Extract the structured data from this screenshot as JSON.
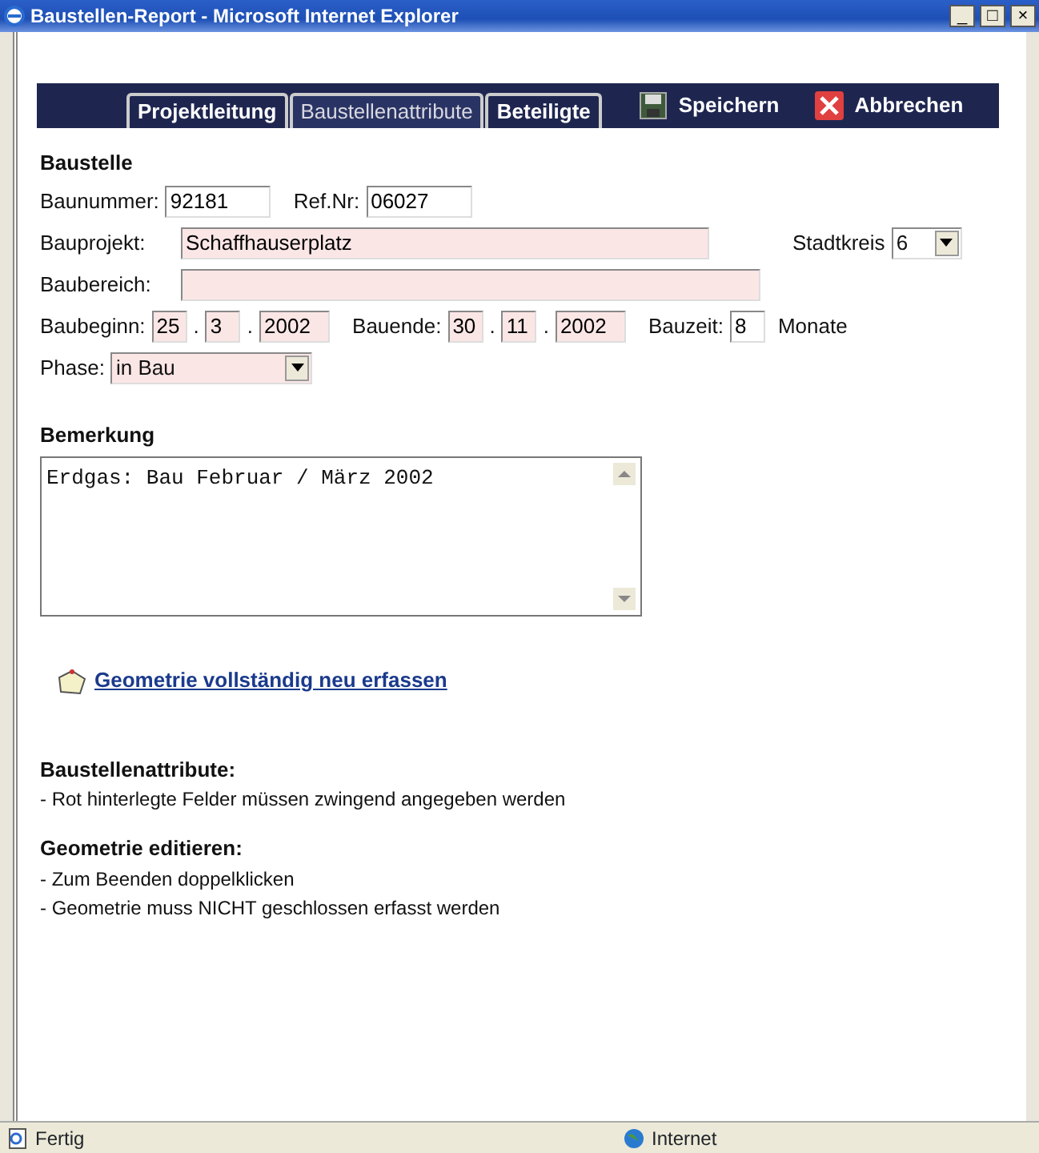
{
  "window": {
    "title": "Baustellen-Report - Microsoft Internet Explorer",
    "controls": [
      "_",
      "□",
      "×"
    ]
  },
  "tabs": [
    {
      "label": "Projektleitung",
      "selected": false
    },
    {
      "label": "Baustellenattribute",
      "selected": true
    },
    {
      "label": "Beteiligte",
      "selected": false
    }
  ],
  "actions": [
    {
      "kind": "save",
      "label": "Speichern"
    },
    {
      "kind": "cancel",
      "label": "Abbrechen"
    }
  ],
  "section_title": "Baustelle",
  "rows": [
    [
      {
        "label": "Baunummer:",
        "value": "92181",
        "required": false
      },
      {
        "label": "Ref.Nr:",
        "value": "06027",
        "required": false
      }
    ],
    [
      {
        "label": "Bauprojekt:",
        "value": "Schaffhauserplatz",
        "required": true
      },
      {
        "label": "Stadtkreis",
        "value": "6",
        "required": false,
        "kind": "select"
      }
    ],
    [
      {
        "label": "Baubereich:",
        "required": true
      }
    ],
    [
      {
        "label": "Baubeginn:",
        "value": "25",
        "required": true
      },
      {
        "label": ".",
        "value": "3",
        "required": true
      },
      {
        "label": ".",
        "value": "2002",
        "required": true
      },
      {
        "label": "Bauende:",
        "value": "30",
        "required": true
      },
      {
        "label": ".",
        "value": "11",
        "required": true
      },
      {
        "label": ".",
        "value": "2002",
        "required": true
      },
      {
        "label": "Bauzeit:",
        "value": "8",
        "required": false,
        "suffix": "Monate"
      }
    ],
    [
      {
        "label": "Phase:",
        "value": "in Bau",
        "required": true,
        "kind": "select"
      }
    ]
  ],
  "remark": {
    "title": "Bemerkung",
    "value": "Erdgas: Bau Februar / März 2002"
  },
  "geometry_link": "Geometrie vollständig neu erfassen",
  "help": [
    {
      "title": "Baustellenattribute:",
      "lines": [
        "- Rot hinterlegte Felder müssen zwingend angegeben werden"
      ]
    },
    {
      "title": "Geometrie editieren:",
      "lines": [
        "- Zum Beenden doppelklicken",
        "- Geometrie muss NICHT geschlossen erfasst werden"
      ]
    }
  ],
  "status_bar": {
    "text": "Fertig",
    "zone": "Internet"
  }
}
